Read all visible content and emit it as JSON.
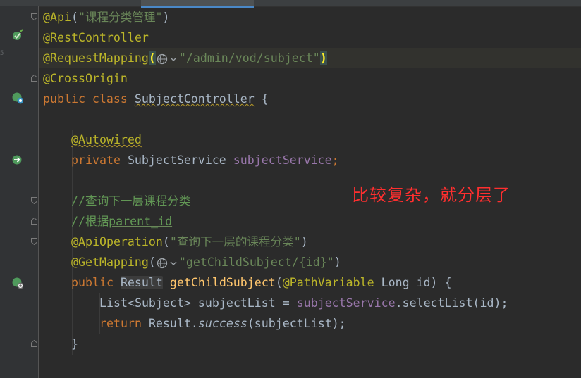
{
  "tabs": [
    "",
    "",
    "",
    "",
    "",
    ""
  ],
  "code": {
    "l1": {
      "ann": "@Api",
      "open": "(",
      "str": "\"课程分类管理\"",
      "close": ")"
    },
    "l2": {
      "ann": "@RestController"
    },
    "l3": {
      "ann": "@RequestMapping",
      "open": "(",
      "q1": "\"",
      "path": "/admin/vod/subject",
      "q2": "\"",
      "close": ")"
    },
    "l4": {
      "ann": "@CrossOrigin"
    },
    "l5": {
      "kw": "public class ",
      "cls": "SubjectController",
      "rest": " {"
    },
    "l7": {
      "ann": "@Autowired"
    },
    "l8": {
      "kw": "private ",
      "type": "SubjectService ",
      "field": "subjectService",
      "semi": ";"
    },
    "l10": {
      "comment": "//查询下一层课程分类"
    },
    "l11": {
      "prefix": "//根据",
      "param": "parent_id"
    },
    "l12": {
      "ann": "@ApiOperation",
      "open": "(",
      "str": "\"查询下一层的课程分类\"",
      "close": ")"
    },
    "l13": {
      "ann": "@GetMapping",
      "open": "(",
      "q1": "\"",
      "path": "getChildSubject/{id}",
      "q2": "\"",
      "close": ")"
    },
    "l14": {
      "kw": "public ",
      "type": "Result",
      "space": " ",
      "method": "getChildSubject",
      "open": "(",
      "ann": "@PathVariable",
      "rest": " Long id) {"
    },
    "l15": {
      "t1": "List<Subject> subjectList = ",
      "field": "subjectService",
      "t2": ".selectList(id);"
    },
    "l16": {
      "kw": "return ",
      "t1": "Result.",
      "method": "success",
      "t2": "(subjectList);"
    },
    "l17": {
      "t": "}"
    }
  },
  "annotation_note": "比较复杂，就分层了",
  "gutter_numbers": [
    "",
    "",
    "5",
    "",
    "",
    "",
    "",
    "",
    "",
    "",
    "",
    "",
    "",
    "",
    "",
    "",
    "",
    ""
  ],
  "icons": {
    "spring_bean": "spring-bean-icon",
    "web_endpoint": "web-endpoint-icon",
    "autowired_nav": "autowired-navigate-icon",
    "globe": "globe-icon",
    "fold": "fold-marker-icon"
  },
  "colors": {
    "background": "#2b2b2b",
    "annotation": "#bbb529",
    "keyword": "#cc7832",
    "string": "#6a8759",
    "comment": "#629755",
    "field": "#9876aa",
    "method": "#ffc66d",
    "text": "#a9b7c6",
    "note": "#ff2f2f"
  }
}
